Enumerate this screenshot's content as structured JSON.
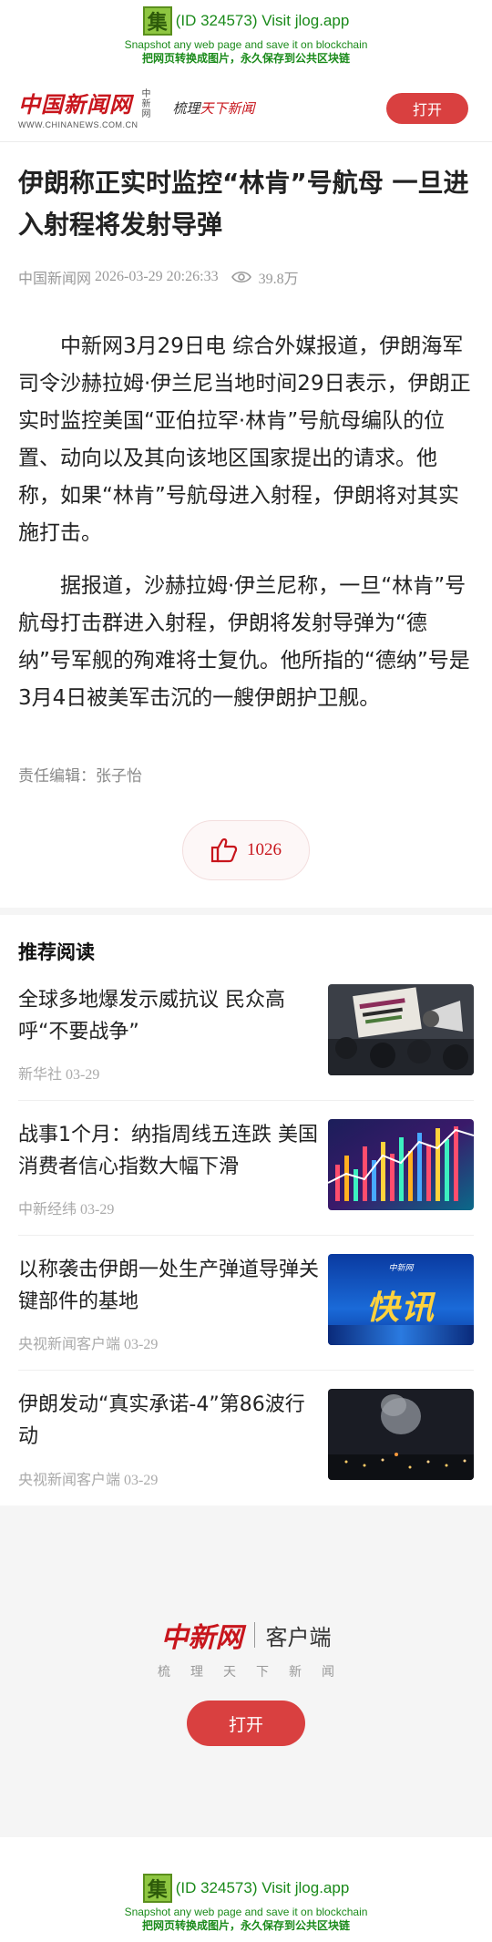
{
  "jlog": {
    "badge": "集",
    "id_text": "(ID 324573) Visit jlog.app",
    "line1": "Snapshot any web page and save it on blockchain",
    "line2": "把网页转换成图片，永久保存到公共区块链"
  },
  "header": {
    "logo_cn": "中国新闻网",
    "logo_en": "WWW.CHINANEWS.COM.CN",
    "logo_side": "中新网",
    "slogan_prefix": "梳理",
    "slogan_accent": "天下新闻",
    "open_label": "打开"
  },
  "article": {
    "headline": "伊朗称正实时监控“林肯”号航母 一旦进入射程将发射导弹",
    "source": "中国新闻网",
    "datetime": "2026-03-29 20:26:33",
    "views": "39.8万",
    "paragraphs": [
      "中新网3月29日电 综合外媒报道，伊朗海军司令沙赫拉姆·伊兰尼当地时间29日表示，伊朗正实时监控美国“亚伯拉罕·林肯”号航母编队的位置、动向以及其向该地区国家提出的请求。他称，如果“林肯”号航母进入射程，伊朗将对其实施打击。",
      "据报道，沙赫拉姆·伊兰尼称，一旦“林肯”号航母打击群进入射程，伊朗将发射导弹为“德纳”号军舰的殉难将士复仇。他所指的“德纳”号是3月4日被美军击沉的一艘伊朗护卫舰。"
    ],
    "editor": "责任编辑：张子怡",
    "likes": "1026"
  },
  "recommended": {
    "title": "推荐阅读",
    "items": [
      {
        "headline": "全球多地爆发示威抗议 民众高呼“不要战争”",
        "meta": "新华社 03-29",
        "thumb": "protest-photo"
      },
      {
        "headline": "战事1个月：纳指周线五连跌 美国消费者信心指数大幅下滑",
        "meta": "中新经纬 03-29",
        "thumb": "stock-chart-graphic"
      },
      {
        "headline": "以称袭击伊朗一处生产弹道导弹关键部件的基地",
        "meta": "央视新闻客户端 03-29",
        "thumb": "express-news-graphic"
      },
      {
        "headline": "伊朗发动“真实承诺-4”第86波行动",
        "meta": "央视新闻客户端 03-29",
        "thumb": "night-city-smoke-photo"
      }
    ],
    "thumb_labels": {
      "express": "快讯",
      "express_top": "中新网"
    }
  },
  "promo": {
    "logo_cn": "中新网",
    "label": "客户端",
    "slogan": "梳理天下新闻",
    "open_label": "打开"
  },
  "colors": {
    "brand_red": "#c8161d",
    "button_red": "#d94040",
    "jlog_green": "#1a8a1a"
  }
}
